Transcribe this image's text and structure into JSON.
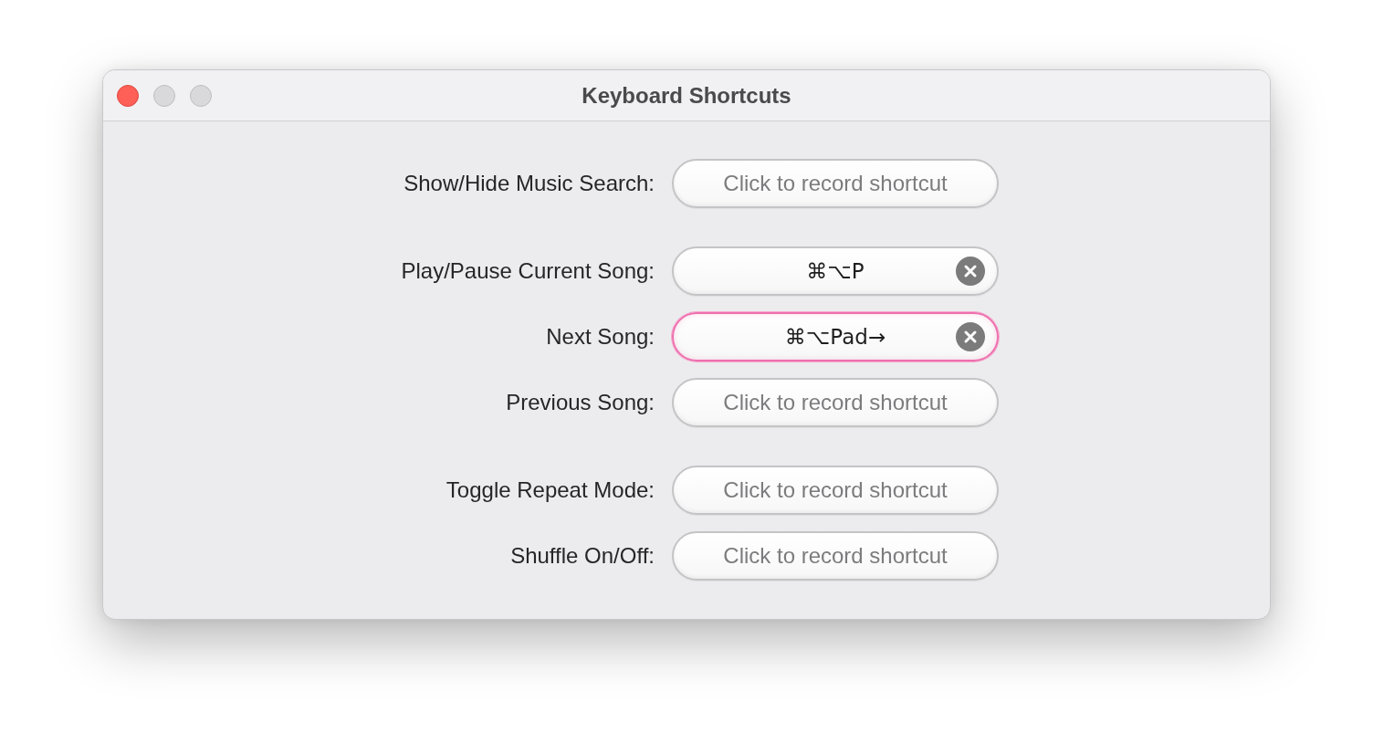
{
  "window": {
    "title": "Keyboard Shortcuts",
    "controls": [
      {
        "kind": "close",
        "disabled": false
      },
      {
        "kind": "minimize",
        "disabled": true
      },
      {
        "kind": "zoom",
        "disabled": true
      }
    ]
  },
  "groups": [
    {
      "rows": [
        {
          "label": "Show/Hide Music Search:",
          "shortcut": {
            "placeholder": "Click to record shortcut",
            "focused": false
          }
        }
      ]
    },
    {
      "rows": [
        {
          "label": "Play/Pause Current Song:",
          "shortcut": {
            "value": "⌘⌥P",
            "focused": false
          }
        },
        {
          "label": "Next Song:",
          "shortcut": {
            "value": "⌘⌥Pad→",
            "focused": true
          }
        },
        {
          "label": "Previous Song:",
          "shortcut": {
            "placeholder": "Click to record shortcut",
            "focused": false
          }
        }
      ]
    },
    {
      "rows": [
        {
          "label": "Toggle Repeat Mode:",
          "shortcut": {
            "placeholder": "Click to record shortcut",
            "focused": false
          }
        },
        {
          "label": "Shuffle On/Off:",
          "shortcut": {
            "placeholder": "Click to record shortcut",
            "focused": false
          }
        }
      ]
    }
  ]
}
